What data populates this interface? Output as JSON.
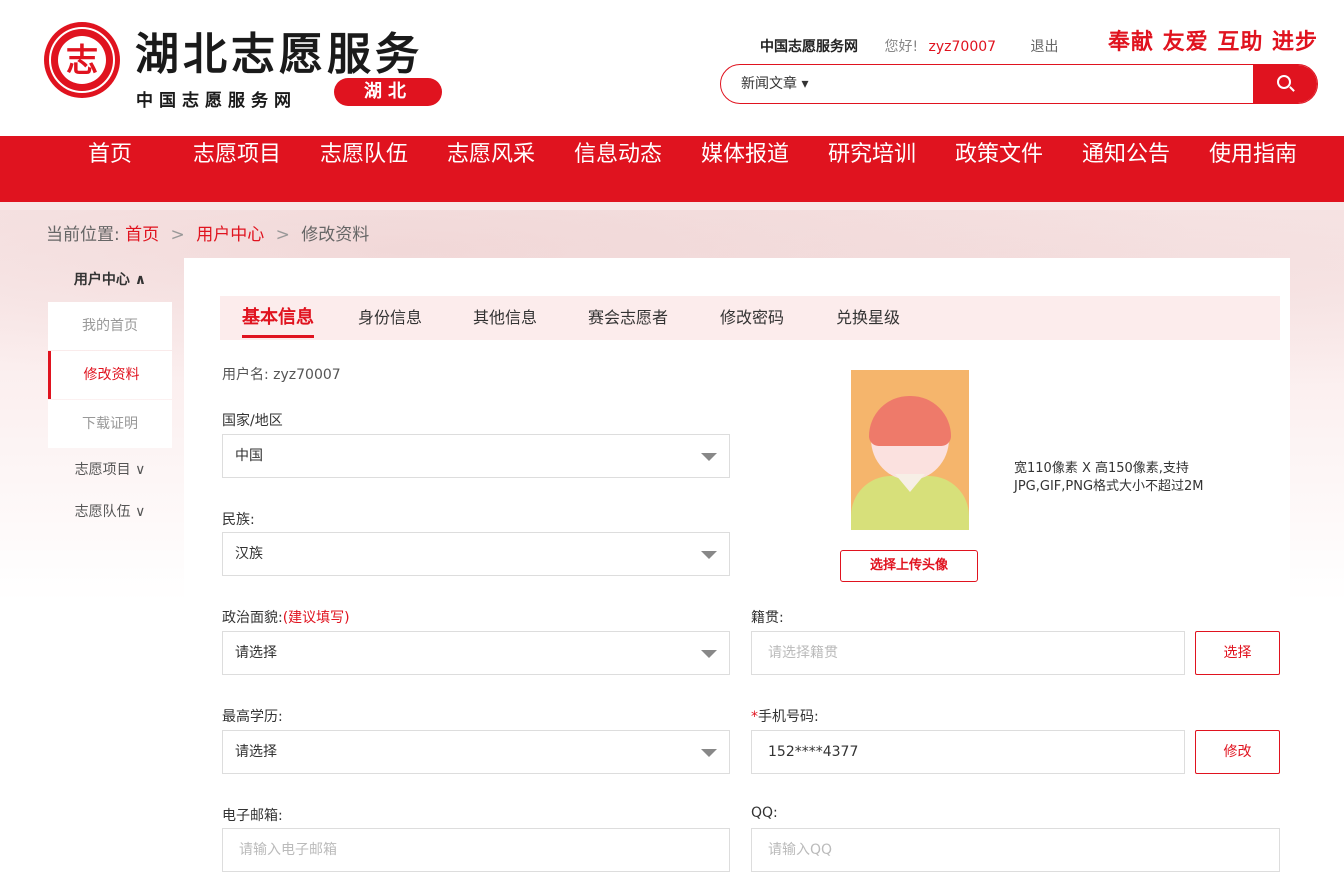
{
  "header": {
    "logo_glyph": "志",
    "title": "湖北志愿服务",
    "subtitle": "中国志愿服务网",
    "province": "湖北",
    "site_link": "中国志愿服务网",
    "greeting": "您好!",
    "username": "zyz70007",
    "logout": "退出",
    "slogan": "奉献 友爱 互助 进步",
    "search": {
      "category": "新闻文章 ▾",
      "placeholder": ""
    }
  },
  "nav": [
    "首页",
    "志愿项目",
    "志愿队伍",
    "志愿风采",
    "信息动态",
    "媒体报道",
    "研究培训",
    "政策文件",
    "通知公告",
    "使用指南"
  ],
  "breadcrumb": {
    "label": "当前位置:",
    "home": "首页",
    "center": "用户中心",
    "current": "修改资料",
    "sep": ">"
  },
  "sidebar": {
    "head": "用户中心 ∧",
    "items": [
      "我的首页",
      "修改资料",
      "下载证明"
    ],
    "groups": [
      "志愿项目 ∨",
      "志愿队伍 ∨"
    ]
  },
  "tabs": [
    "基本信息",
    "身份信息",
    "其他信息",
    "赛会志愿者",
    "修改密码",
    "兑换星级"
  ],
  "form": {
    "username_line": "用户名: zyz70007",
    "country_label": "国家/地区",
    "country_value": "中国",
    "ethnic_label": "民族:",
    "ethnic_value": "汉族",
    "political_label": "政治面貌:",
    "political_hint": "(建议填写)",
    "political_value": "请选择",
    "native_label": "籍贯:",
    "native_placeholder": "请选择籍贯",
    "native_btn": "选择",
    "edu_label": "最高学历:",
    "edu_value": "请选择",
    "phone_req": "*",
    "phone_label": "手机号码:",
    "phone_value": "152****4377",
    "phone_btn": "修改",
    "email_label": "电子邮箱:",
    "email_placeholder": "请输入电子邮箱",
    "qq_label": "QQ:",
    "qq_placeholder": "请输入QQ"
  },
  "avatar": {
    "note_line1": "宽110像素 X 高150像素,支持",
    "note_line2": "JPG,GIF,PNG格式大小不超过2M",
    "upload_btn": "选择上传头像"
  },
  "colors": {
    "brand": "#e0131f",
    "tab_bg": "#fcecec"
  }
}
